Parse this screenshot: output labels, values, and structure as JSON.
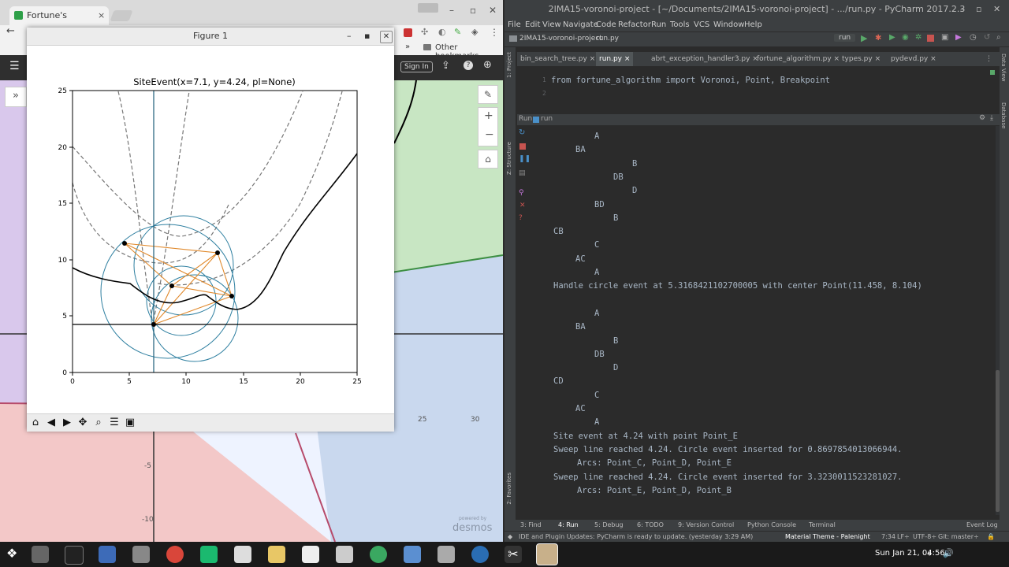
{
  "chrome": {
    "tab_title": "Fortune's Algorithm",
    "bookmarks_overflow": "»",
    "other_bookmarks": "Other bookmarks",
    "sign_in": "Sign In"
  },
  "figure": {
    "window_title": "Figure 1",
    "plot_title": "SiteEvent(x=7.1, y=4.24, pl=None)",
    "x_ticks": [
      "0",
      "5",
      "10",
      "15",
      "20",
      "25"
    ],
    "y_ticks": [
      "0",
      "5",
      "10",
      "15",
      "20",
      "25"
    ]
  },
  "desmos": {
    "x_labels": [
      "25",
      "30"
    ],
    "y_labels": [
      "-5",
      "-10"
    ],
    "watermark_small": "powered by",
    "watermark": "desmos"
  },
  "pycharm": {
    "title": "2IMA15-voronoi-project - [~/Documents/2IMA15-voronoi-project] - .../run.py - PyCharm 2017.2.3",
    "menu": [
      "File",
      "Edit",
      "View",
      "Navigate",
      "Code",
      "Refactor",
      "Run",
      "Tools",
      "VCS",
      "Window",
      "Help"
    ],
    "breadcrumb_project": "2IMA15-voronoi-project",
    "breadcrumb_file": "run.py",
    "run_config": "run",
    "tabs": [
      "bin_search_tree.py",
      "run.py",
      "abrt_exception_handler3.py",
      "fortune_algorithm.py",
      "types.py",
      "pydevd.py"
    ],
    "editor_lines": [
      "from fortune_algorithm import Voronoi, Point, Breakpoint",
      ""
    ],
    "line_numbers": [
      "1",
      "2"
    ],
    "run_label": "Run",
    "run_name": "run",
    "console": [
      {
        "indent": 2,
        "text": "A"
      },
      {
        "indent": 1,
        "text": "BA"
      },
      {
        "indent": 4,
        "text": "B"
      },
      {
        "indent": 3,
        "text": "DB"
      },
      {
        "indent": 4,
        "text": "D"
      },
      {
        "indent": 2,
        "text": "BD"
      },
      {
        "indent": 3,
        "text": "B"
      },
      {
        "indent": 0,
        "text": "CB"
      },
      {
        "indent": 2,
        "text": "C"
      },
      {
        "indent": 1,
        "text": "AC"
      },
      {
        "indent": 2,
        "text": "A"
      },
      {
        "indent": 0,
        "text": "Handle circle event at 5.3168421102700005 with center Point(11.458, 8.104)"
      },
      {
        "indent": 0,
        "text": ""
      },
      {
        "indent": 2,
        "text": "A"
      },
      {
        "indent": 1,
        "text": "BA"
      },
      {
        "indent": 3,
        "text": "B"
      },
      {
        "indent": 2,
        "text": "DB"
      },
      {
        "indent": 3,
        "text": "D"
      },
      {
        "indent": 0,
        "text": "CD"
      },
      {
        "indent": 2,
        "text": "C"
      },
      {
        "indent": 1,
        "text": "AC"
      },
      {
        "indent": 2,
        "text": "A"
      },
      {
        "indent": 0,
        "text": "Site event at 4.24 with point Point_E"
      },
      {
        "indent": 0,
        "text": "Sweep line reached 4.24. Circle event inserted for 0.8697854013066944."
      },
      {
        "indent": 1,
        "text": "Arcs: Point_C, Point_D, Point_E"
      },
      {
        "indent": 0,
        "text": "Sweep line reached 4.24. Circle event inserted for 3.3230011523281027."
      },
      {
        "indent": 1,
        "text": "Arcs: Point_E, Point_D, Point_B"
      }
    ],
    "bottom_tabs": [
      "3: Find",
      "4: Run",
      "5: Debug",
      "6: TODO",
      "9: Version Control",
      "Python Console",
      "Terminal"
    ],
    "event_log": "Event Log",
    "status_message": "IDE and Plugin Updates: PyCharm is ready to update. (yesterday 3:29 AM)",
    "theme": "Material Theme - Palenight",
    "cursor_pos": "7:34",
    "line_sep": "LF÷",
    "encoding": "UTF-8÷",
    "git": "Git: master÷"
  },
  "taskbar": {
    "clock": "Sun Jan 21, 04:56"
  }
}
